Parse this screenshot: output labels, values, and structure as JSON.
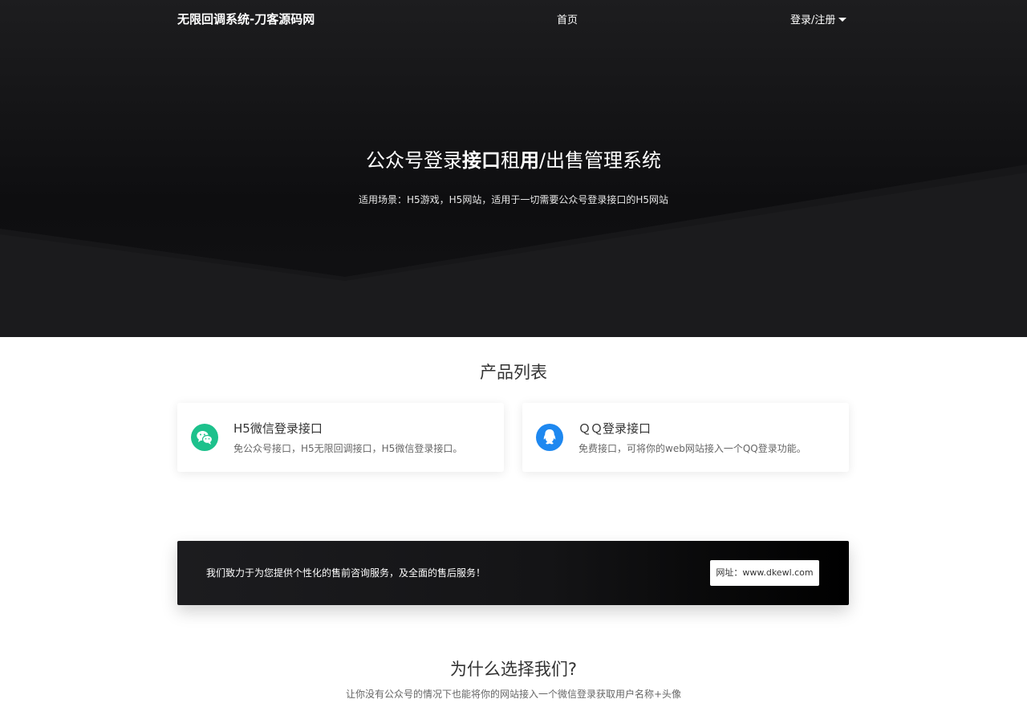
{
  "nav": {
    "brand": "无限回调系统-刀客源码网",
    "home": "首页",
    "login": "登录/注册"
  },
  "hero": {
    "title_parts": [
      "公众号登录",
      "接口",
      "租",
      "用",
      "/出售管理系统"
    ],
    "subtitle": "适用场景：H5游戏，H5网站，适用于一切需要公众号登录接口的H5网站"
  },
  "products": {
    "title": "产品列表",
    "items": [
      {
        "title": "H5微信登录接口",
        "desc": "免公众号接口，H5无限回调接口，H5微信登录接口。",
        "icon": "wechat-icon",
        "color": "#1dc18c"
      },
      {
        "title": "ＱＱ登录接口",
        "desc": "免费接口，可将你的web网站接入一个QQ登录功能。",
        "icon": "qq-icon",
        "color": "#1e88f0"
      }
    ]
  },
  "banner": {
    "text": "我们致力于为您提供个性化的售前咨询服务，及全面的售后服务！",
    "button": "网址：www.dkewl.com"
  },
  "why": {
    "title": "为什么选择我们?",
    "subtitle": "让你没有公众号的情况下也能将你的网站接入一个微信登录获取用户名称+头像"
  }
}
